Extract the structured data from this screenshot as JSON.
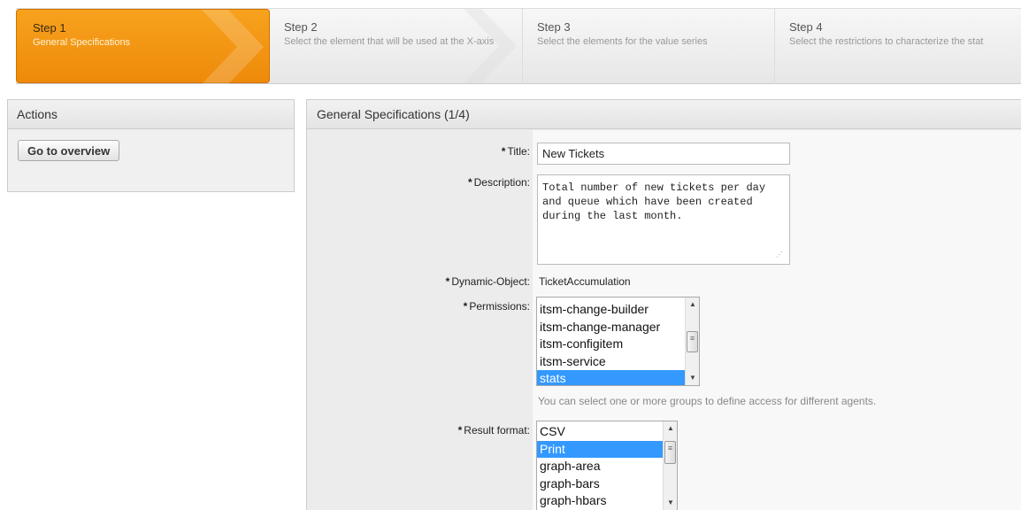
{
  "wizard": {
    "steps": [
      {
        "number": "Step 1",
        "description": "General Specifications"
      },
      {
        "number": "Step 2",
        "description": "Select the element that will be used at the X-axis"
      },
      {
        "number": "Step 3",
        "description": "Select the elements for the value series"
      },
      {
        "number": "Step 4",
        "description": "Select the restrictions to characterize the stat"
      }
    ],
    "active_step": 1
  },
  "actions": {
    "title": "Actions",
    "go_to_overview_label": "Go to overview"
  },
  "form": {
    "title": "General Specifications (1/4)",
    "required_marker": "*",
    "title_label": "Title:",
    "title_value": "New Tickets",
    "description_label": "Description:",
    "description_value": "Total number of new tickets per day and queue which have been created during the last month.",
    "dynamic_object_label": "Dynamic-Object:",
    "dynamic_object_value": "TicketAccumulation",
    "permissions_label": "Permissions:",
    "permissions_options": [
      {
        "label": "itsm-change-builder",
        "selected": false
      },
      {
        "label": "itsm-change-manager",
        "selected": false
      },
      {
        "label": "itsm-configitem",
        "selected": false
      },
      {
        "label": "itsm-service",
        "selected": false
      },
      {
        "label": "stats",
        "selected": true
      }
    ],
    "permissions_hint": "You can select one or more groups to define access for different agents.",
    "result_format_label": "Result format:",
    "result_format_options": [
      {
        "label": "CSV",
        "selected": false
      },
      {
        "label": "Print",
        "selected": true
      },
      {
        "label": "graph-area",
        "selected": false
      },
      {
        "label": "graph-bars",
        "selected": false
      },
      {
        "label": "graph-hbars",
        "selected": false
      }
    ]
  },
  "colors": {
    "active_step": "#f19415",
    "selection": "#3399ff"
  }
}
